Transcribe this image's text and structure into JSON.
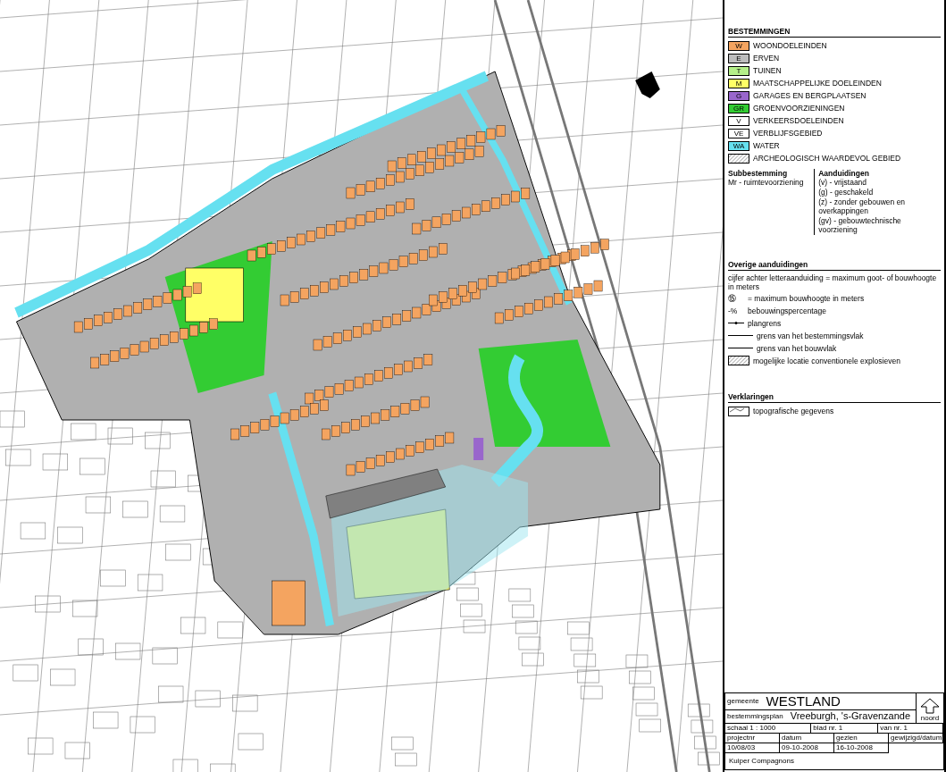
{
  "legend": {
    "title": "BESTEMMINGEN",
    "columns": [
      "Subbestemming",
      "Aanduidingen"
    ],
    "items": [
      {
        "kind": "swatch",
        "code": "W",
        "label": "WOONDOELEINDEN",
        "color": "#f4a460"
      },
      {
        "kind": "swatch",
        "code": "E",
        "label": "ERVEN",
        "color": "#bdbdbd"
      },
      {
        "kind": "swatch",
        "code": "T",
        "label": "TUINEN",
        "color": "#b5f08a"
      },
      {
        "kind": "swatch",
        "code": "M",
        "label": "MAATSCHAPPELIJKE DOELEINDEN",
        "color": "#ffff66"
      },
      {
        "kind": "swatch",
        "code": "G",
        "label": "GARAGES EN BERGPLAATSEN",
        "color": "#9966cc"
      },
      {
        "kind": "swatch",
        "code": "GR",
        "label": "GROENVOORZIENINGEN",
        "color": "#33cc33"
      },
      {
        "kind": "swatch",
        "code": "V",
        "label": "VERKEERSDOELEINDEN",
        "color": "#ffffff"
      },
      {
        "kind": "swatch",
        "code": "VE",
        "label": "VERBLIJFSGEBIED",
        "color": "#ffffff"
      },
      {
        "kind": "swatch",
        "code": "WA",
        "label": "WATER",
        "color": "#66e0f0"
      },
      {
        "kind": "hatch",
        "label": "ARCHEOLOGISCH WAARDEVOL GEBIED"
      }
    ],
    "subbestemming": [
      "Mr - ruimtevoorziening"
    ],
    "aanduidingen": [
      "(v) - vrijstaand",
      "(g) - geschakeld",
      "(z) - zonder gebouwen en overkappingen",
      "(gv) - gebouwtechnische voorziening"
    ]
  },
  "other": {
    "title": "Overige aanduidingen",
    "items": [
      {
        "kind": "text",
        "label": "cijfer achter letteraanduiding = maximum goot- of bouwhoogte in meters"
      },
      {
        "kind": "symbol",
        "symbol": "⑮",
        "label": "= maximum bouwhoogte in meters"
      },
      {
        "kind": "symbol",
        "symbol": "-%",
        "label": "bebouwingspercentage"
      },
      {
        "kind": "arrow-line",
        "label": "plangrens"
      },
      {
        "kind": "line",
        "label": "grens van het bestemmingsvlak"
      },
      {
        "kind": "line",
        "label": "grens van het bouwvlak"
      },
      {
        "kind": "hatch",
        "label": "mogelijke locatie conventionele explosieven"
      }
    ]
  },
  "explanations": {
    "title": "Verklaringen",
    "items": [
      {
        "kind": "topo",
        "label": "topografische gegevens"
      }
    ]
  },
  "title_block": {
    "municipality_label": "gemeente",
    "municipality": "WESTLAND",
    "plan_label": "bestemmingsplan",
    "plan": "Vreeburgh, 's-Gravenzande",
    "north": "noord",
    "row": [
      "schaal 1 : 1000",
      "blad nr. 1",
      "van nr. 1"
    ],
    "headers": [
      "projectnr",
      "datum",
      "gezien",
      "gewijzigd/datum"
    ],
    "values": [
      "10/08/03",
      "09-10-2008",
      "16-10-2008"
    ],
    "company": "Kuiper Compagnons"
  }
}
